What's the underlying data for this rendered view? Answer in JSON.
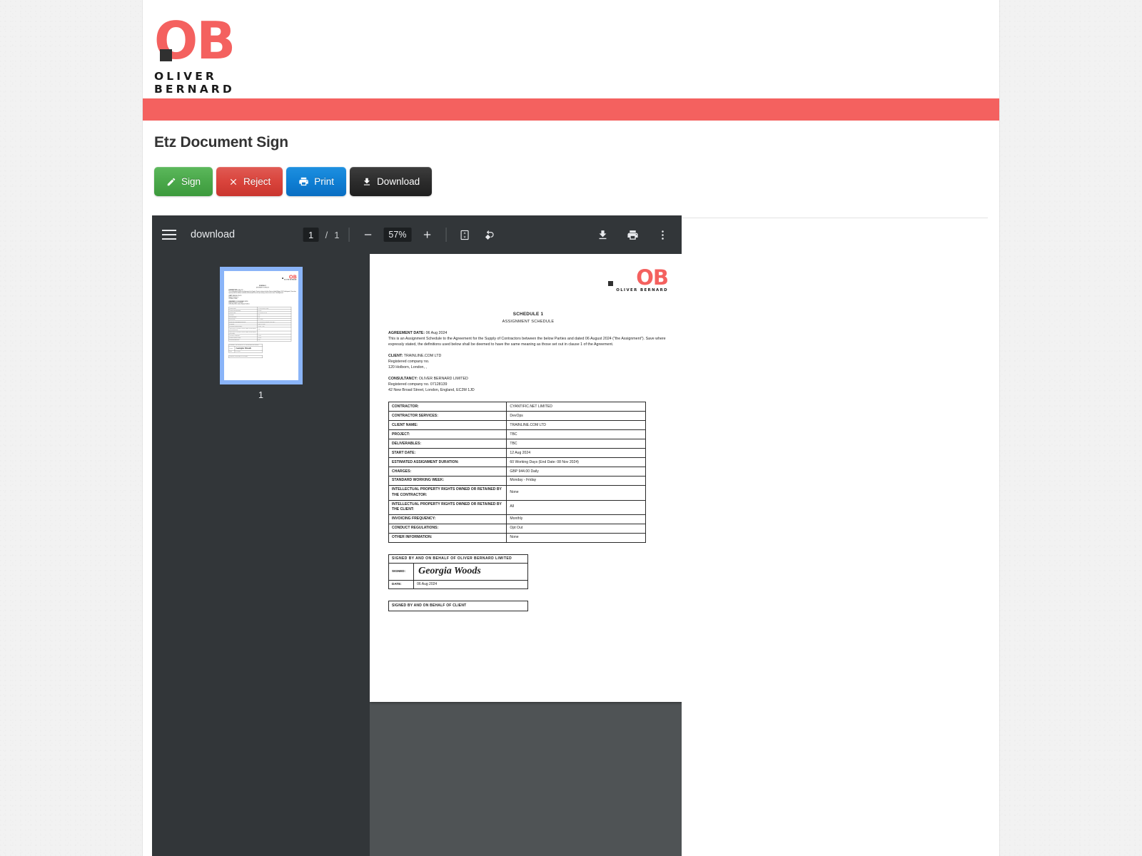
{
  "brand": {
    "logo_mark": "OB",
    "logo_sub": "OLIVER BERNARD",
    "accent_color": "#f4615f"
  },
  "header": {
    "title": "Etz Document Sign"
  },
  "actions": [
    {
      "id": "sign",
      "label": "Sign",
      "icon": "pencil-icon",
      "color": "#4aa84a"
    },
    {
      "id": "reject",
      "label": "Reject",
      "icon": "x-mark-icon",
      "color": "#d9443c"
    },
    {
      "id": "print",
      "label": "Print",
      "icon": "printer-icon",
      "color": "#0f7fd4"
    },
    {
      "id": "download",
      "label": "Download",
      "icon": "download-icon",
      "color": "#2c2c2c"
    }
  ],
  "pdf_viewer": {
    "filename": "download",
    "page_current": "1",
    "page_separator": "/",
    "page_total": "1",
    "zoom_level": "57%",
    "thumbnail_label": "1"
  },
  "document": {
    "logo_mark": "OB",
    "logo_sub": "OLIVER BERNARD",
    "title": "SCHEDULE 1",
    "subtitle": "ASSIGNMENT SCHEDULE",
    "agreement_date_label": "AGREEMENT DATE:",
    "agreement_date_value": "06 Aug 2024",
    "intro_paragraph": "This is an Assignment Schedule to the Agreement for the Supply of Contractors between the below Parties and dated 06 August 2024 (\"the Assignment\"). Save where expressly stated, the definitions used below shall be deemed to have the same meaning as those set out in clause 1 of the Agreement.",
    "client_label": "CLIENT:",
    "client_value": "TRAINLINE.COM LTD",
    "client_reg": "Registered company no.",
    "client_address": "120 Holborn, London, ,",
    "consultancy_label": "CONSULTANCY:",
    "consultancy_value": "OLIVER BERNARD LIMITED",
    "consultancy_reg": "Registered company no. 07128139",
    "consultancy_address": "42 New Broad Street, London, England, EC2M 1JD",
    "table_rows": [
      {
        "key": "CONTRACTOR:",
        "value": "CYANTIFIC.NET LIMITED"
      },
      {
        "key": "CONTRACTOR SERVICES:",
        "value": "DevOps"
      },
      {
        "key": "CLIENT NAME:",
        "value": "TRAINLINE.COM LTD"
      },
      {
        "key": "PROJECT:",
        "value": "TBC"
      },
      {
        "key": "DELIVERABLES:",
        "value": "TBC"
      },
      {
        "key": "START DATE:",
        "value": "12 Aug 2024"
      },
      {
        "key": "ESTIMATED ASSIGNMENT DURATION:",
        "value": "60 Working Days (End Date: 08 Nov 2024)"
      },
      {
        "key": "CHARGES:",
        "value": "GBP 944.00 Daily"
      },
      {
        "key": "STANDARD WORKING WEEK:",
        "value": "Monday - Friday"
      },
      {
        "key": "INTELLECTUAL PROPERTY RIGHTS OWNED OR RETAINED BY THE CONTRACTOR:",
        "value": "None"
      },
      {
        "key": "INTELLECTUAL PROPERTY RIGHTS OWNED OR RETAINED BY THE CLIENT:",
        "value": "All"
      },
      {
        "key": "INVOICING FREQUENCY:",
        "value": "Monthly"
      },
      {
        "key": "CONDUCT REGULATIONS:",
        "value": "Opt Out"
      },
      {
        "key": "OTHER INFORMATION:",
        "value": "None"
      }
    ],
    "signature_block": {
      "heading": "SIGNED BY AND ON BEHALF OF OLIVER BERNARD LIMITED",
      "signed_label": "SIGNED:",
      "signed_name": "Georgia Woods",
      "date_label": "DATE:",
      "date_value": "06 Aug 2024"
    },
    "client_signature_block": {
      "heading": "SIGNED BY AND ON BEHALF OF CLIENT"
    }
  }
}
